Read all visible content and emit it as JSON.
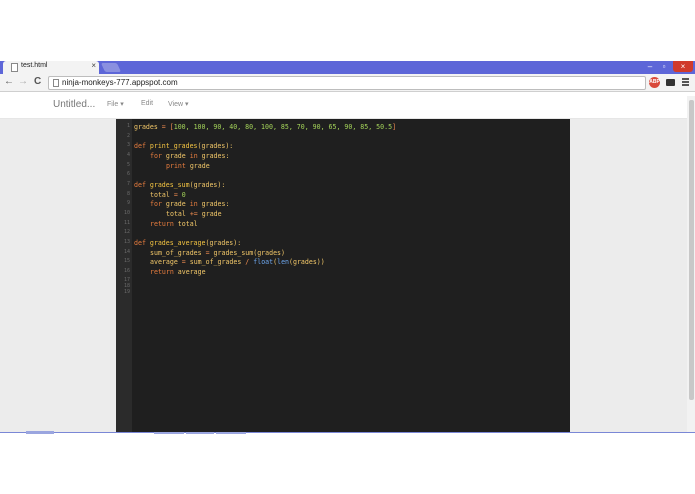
{
  "browser": {
    "tab_title": "test.html",
    "tab_close": "×",
    "url": "ninja-monkeys-777.appspot.com",
    "window_min": "–",
    "window_max": "▫",
    "window_close": "×",
    "nav_back": "←",
    "nav_forward": "→",
    "nav_reload": "C",
    "extension_abp": "ABP"
  },
  "app": {
    "doc_title": "Untitled...",
    "menu": {
      "file": "File ▾",
      "edit": "Edit",
      "view": "View ▾"
    }
  },
  "editor": {
    "line_numbers": [
      "1",
      "2",
      "3",
      "4",
      "5",
      "6",
      "7",
      "8",
      "9",
      "10",
      "11",
      "12",
      "13",
      "14",
      "15",
      "16",
      "17",
      "18",
      "19"
    ],
    "code": {
      "l1": {
        "a": "grades",
        "b": " = [",
        "c": "100, 100, 90, 40, 80, 100, 85, 70, 90, 65, 90, 85, 50.5",
        "d": "]"
      },
      "l3": {
        "kw": "def ",
        "fn": "print_grades",
        "rest": "(grades):"
      },
      "l4": {
        "kw": "for ",
        "a": "grade ",
        "kw2": "in ",
        "b": "grades:"
      },
      "l5": {
        "kw": "print ",
        "a": "grade"
      },
      "l7": {
        "kw": "def ",
        "fn": "grades_sum",
        "rest": "(grades):"
      },
      "l8": {
        "a": "total ",
        "op": "= ",
        "num": "0"
      },
      "l9": {
        "kw": "for ",
        "a": "grade ",
        "kw2": "in ",
        "b": "grades:"
      },
      "l10": {
        "a": "total ",
        "op": "+= ",
        "b": "grade"
      },
      "l11": {
        "kw": "return ",
        "a": "total"
      },
      "l13": {
        "kw": "def ",
        "fn": "grades_average",
        "rest": "(grades):"
      },
      "l14": {
        "a": "sum_of_grades ",
        "op": "= ",
        "b": "grades_sum(grades)"
      },
      "l15": {
        "a": "average ",
        "op": "= ",
        "b": "sum_of_grades ",
        "op2": "/ ",
        "bi": "float",
        "c": "(",
        "bi2": "len",
        "d": "(grades))"
      },
      "l16": {
        "kw": "return ",
        "a": "average"
      }
    }
  },
  "colors": {
    "tabstrip": "#5d66d8",
    "editor_bg": "#1f1f1f",
    "close_button": "#d03a2c"
  }
}
